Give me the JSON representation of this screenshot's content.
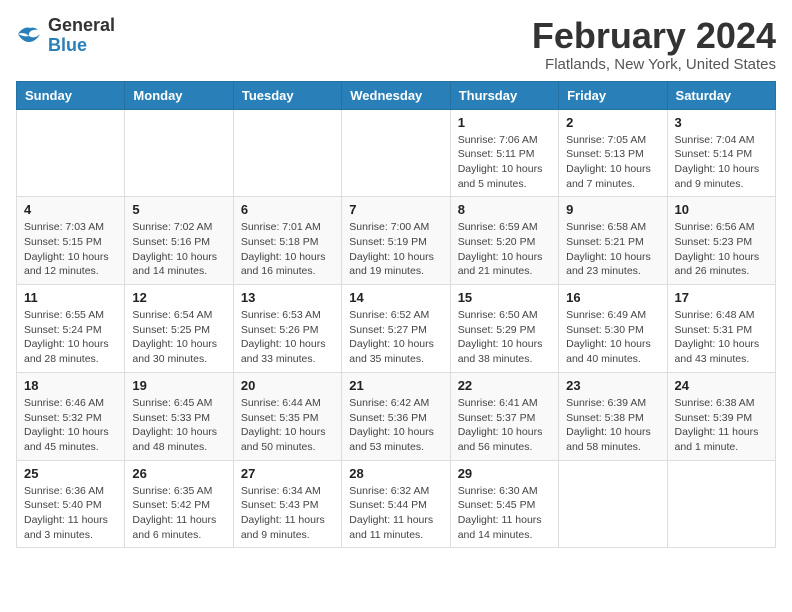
{
  "header": {
    "logo": {
      "general": "General",
      "blue": "Blue"
    },
    "title": "February 2024",
    "location": "Flatlands, New York, United States"
  },
  "weekdays": [
    "Sunday",
    "Monday",
    "Tuesday",
    "Wednesday",
    "Thursday",
    "Friday",
    "Saturday"
  ],
  "weeks": [
    [
      {
        "day": "",
        "info": ""
      },
      {
        "day": "",
        "info": ""
      },
      {
        "day": "",
        "info": ""
      },
      {
        "day": "",
        "info": ""
      },
      {
        "day": "1",
        "info": "Sunrise: 7:06 AM\nSunset: 5:11 PM\nDaylight: 10 hours\nand 5 minutes."
      },
      {
        "day": "2",
        "info": "Sunrise: 7:05 AM\nSunset: 5:13 PM\nDaylight: 10 hours\nand 7 minutes."
      },
      {
        "day": "3",
        "info": "Sunrise: 7:04 AM\nSunset: 5:14 PM\nDaylight: 10 hours\nand 9 minutes."
      }
    ],
    [
      {
        "day": "4",
        "info": "Sunrise: 7:03 AM\nSunset: 5:15 PM\nDaylight: 10 hours\nand 12 minutes."
      },
      {
        "day": "5",
        "info": "Sunrise: 7:02 AM\nSunset: 5:16 PM\nDaylight: 10 hours\nand 14 minutes."
      },
      {
        "day": "6",
        "info": "Sunrise: 7:01 AM\nSunset: 5:18 PM\nDaylight: 10 hours\nand 16 minutes."
      },
      {
        "day": "7",
        "info": "Sunrise: 7:00 AM\nSunset: 5:19 PM\nDaylight: 10 hours\nand 19 minutes."
      },
      {
        "day": "8",
        "info": "Sunrise: 6:59 AM\nSunset: 5:20 PM\nDaylight: 10 hours\nand 21 minutes."
      },
      {
        "day": "9",
        "info": "Sunrise: 6:58 AM\nSunset: 5:21 PM\nDaylight: 10 hours\nand 23 minutes."
      },
      {
        "day": "10",
        "info": "Sunrise: 6:56 AM\nSunset: 5:23 PM\nDaylight: 10 hours\nand 26 minutes."
      }
    ],
    [
      {
        "day": "11",
        "info": "Sunrise: 6:55 AM\nSunset: 5:24 PM\nDaylight: 10 hours\nand 28 minutes."
      },
      {
        "day": "12",
        "info": "Sunrise: 6:54 AM\nSunset: 5:25 PM\nDaylight: 10 hours\nand 30 minutes."
      },
      {
        "day": "13",
        "info": "Sunrise: 6:53 AM\nSunset: 5:26 PM\nDaylight: 10 hours\nand 33 minutes."
      },
      {
        "day": "14",
        "info": "Sunrise: 6:52 AM\nSunset: 5:27 PM\nDaylight: 10 hours\nand 35 minutes."
      },
      {
        "day": "15",
        "info": "Sunrise: 6:50 AM\nSunset: 5:29 PM\nDaylight: 10 hours\nand 38 minutes."
      },
      {
        "day": "16",
        "info": "Sunrise: 6:49 AM\nSunset: 5:30 PM\nDaylight: 10 hours\nand 40 minutes."
      },
      {
        "day": "17",
        "info": "Sunrise: 6:48 AM\nSunset: 5:31 PM\nDaylight: 10 hours\nand 43 minutes."
      }
    ],
    [
      {
        "day": "18",
        "info": "Sunrise: 6:46 AM\nSunset: 5:32 PM\nDaylight: 10 hours\nand 45 minutes."
      },
      {
        "day": "19",
        "info": "Sunrise: 6:45 AM\nSunset: 5:33 PM\nDaylight: 10 hours\nand 48 minutes."
      },
      {
        "day": "20",
        "info": "Sunrise: 6:44 AM\nSunset: 5:35 PM\nDaylight: 10 hours\nand 50 minutes."
      },
      {
        "day": "21",
        "info": "Sunrise: 6:42 AM\nSunset: 5:36 PM\nDaylight: 10 hours\nand 53 minutes."
      },
      {
        "day": "22",
        "info": "Sunrise: 6:41 AM\nSunset: 5:37 PM\nDaylight: 10 hours\nand 56 minutes."
      },
      {
        "day": "23",
        "info": "Sunrise: 6:39 AM\nSunset: 5:38 PM\nDaylight: 10 hours\nand 58 minutes."
      },
      {
        "day": "24",
        "info": "Sunrise: 6:38 AM\nSunset: 5:39 PM\nDaylight: 11 hours\nand 1 minute."
      }
    ],
    [
      {
        "day": "25",
        "info": "Sunrise: 6:36 AM\nSunset: 5:40 PM\nDaylight: 11 hours\nand 3 minutes."
      },
      {
        "day": "26",
        "info": "Sunrise: 6:35 AM\nSunset: 5:42 PM\nDaylight: 11 hours\nand 6 minutes."
      },
      {
        "day": "27",
        "info": "Sunrise: 6:34 AM\nSunset: 5:43 PM\nDaylight: 11 hours\nand 9 minutes."
      },
      {
        "day": "28",
        "info": "Sunrise: 6:32 AM\nSunset: 5:44 PM\nDaylight: 11 hours\nand 11 minutes."
      },
      {
        "day": "29",
        "info": "Sunrise: 6:30 AM\nSunset: 5:45 PM\nDaylight: 11 hours\nand 14 minutes."
      },
      {
        "day": "",
        "info": ""
      },
      {
        "day": "",
        "info": ""
      }
    ]
  ]
}
